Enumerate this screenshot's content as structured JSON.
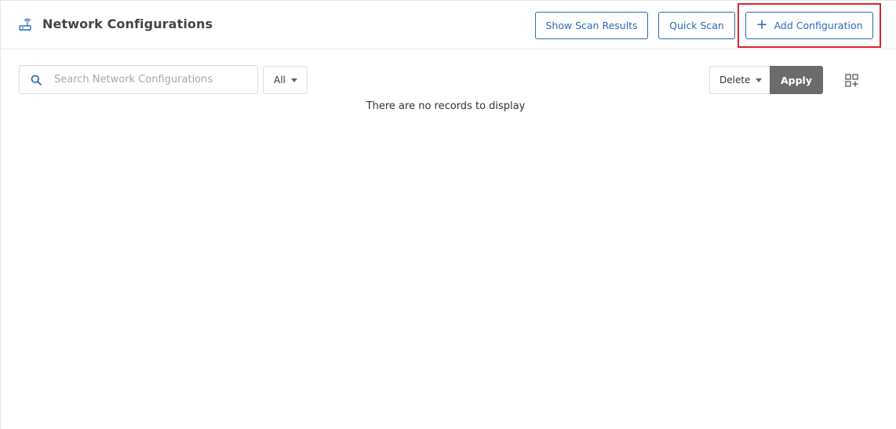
{
  "header": {
    "title": "Network Configurations",
    "title_icon": "router-icon",
    "buttons": {
      "show_scan_results": "Show Scan Results",
      "quick_scan": "Quick Scan",
      "add_configuration": "Add Configuration",
      "add_icon": "+"
    }
  },
  "toolbar": {
    "search_placeholder": "Search Network Configurations",
    "search_value": "",
    "filter_selected": "All",
    "bulk_action_selected": "Delete",
    "apply_label": "Apply",
    "grid_icon": "grid-add-icon"
  },
  "table": {
    "empty_message": "There are no records to display"
  },
  "colors": {
    "accent": "#2a6db5",
    "highlight": "#d9262c",
    "apply_bg": "#6b6b6b"
  }
}
